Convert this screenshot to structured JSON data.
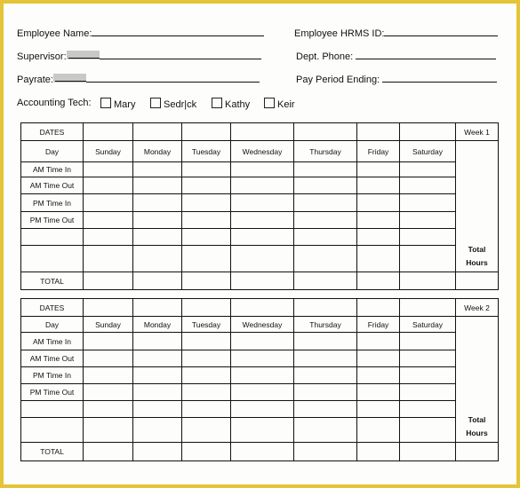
{
  "colors": {
    "border": "#e6c43a",
    "page": "#fdfdfb"
  },
  "fields": {
    "employee_name": "Employee Name:",
    "employee_hrms_id": "Employee HRMS ID:",
    "supervisor": "Supervisor:",
    "dept_phone": "Dept. Phone:",
    "payrate": "Payrate:",
    "pay_period_ending": "Pay Period Ending:"
  },
  "accounting_tech": {
    "label": "Accounting Tech:",
    "options": [
      "Mary",
      "Sedr|ck",
      "Kathy",
      "Keir"
    ]
  },
  "table": {
    "dates": "DATES",
    "day": "Day",
    "days": [
      "Sunday",
      "Monday",
      "Tuesday",
      "Wednesday",
      "Thursday",
      "Friday",
      "Saturday"
    ],
    "rows": [
      "AM Time In",
      "AM Time Out",
      "PM Time In",
      "PM Time Out"
    ],
    "total": "TOTAL",
    "total_hours_1": "Total",
    "total_hours_2": "Hours"
  },
  "weeks": [
    "Week 1",
    "Week 2"
  ]
}
